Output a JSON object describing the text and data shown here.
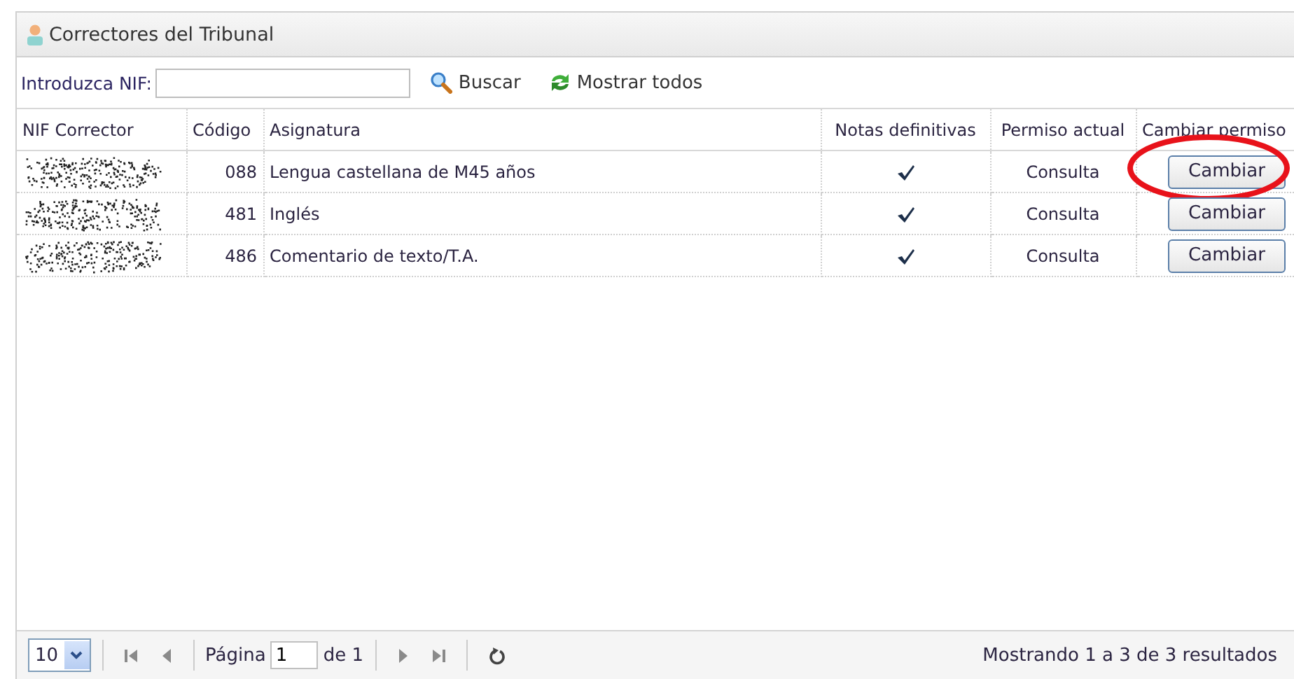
{
  "panel": {
    "title": "Correctores del Tribunal"
  },
  "search": {
    "label": "Introduzca NIF:"
  },
  "toolbar_buttons": [
    {
      "kind": "search",
      "label": "Buscar"
    },
    {
      "kind": "refresh",
      "label": "Mostrar todos"
    }
  ],
  "table": {
    "columns": [
      "NIF Corrector",
      "Código",
      "Asignatura",
      "Notas definitivas",
      "Permiso actual",
      "Cambiar permiso"
    ],
    "rows": [
      {
        "codigo": "088",
        "asignatura": "Lengua castellana de M45 años",
        "notas_definitivas": true,
        "permiso_actual": "Consulta",
        "action": "Cambiar",
        "circled": true
      },
      {
        "codigo": "481",
        "asignatura": "Inglés",
        "notas_definitivas": true,
        "permiso_actual": "Consulta",
        "action": "Cambiar",
        "circled": false
      },
      {
        "codigo": "486",
        "asignatura": "Comentario de texto/T.A.",
        "notas_definitivas": true,
        "permiso_actual": "Consulta",
        "action": "Cambiar",
        "circled": false
      }
    ]
  },
  "pager": {
    "page_size": "10",
    "page_label": "Página",
    "page": "1",
    "of_label": "de 1",
    "summary": "Mostrando 1 a 3 de 3 resultados"
  }
}
